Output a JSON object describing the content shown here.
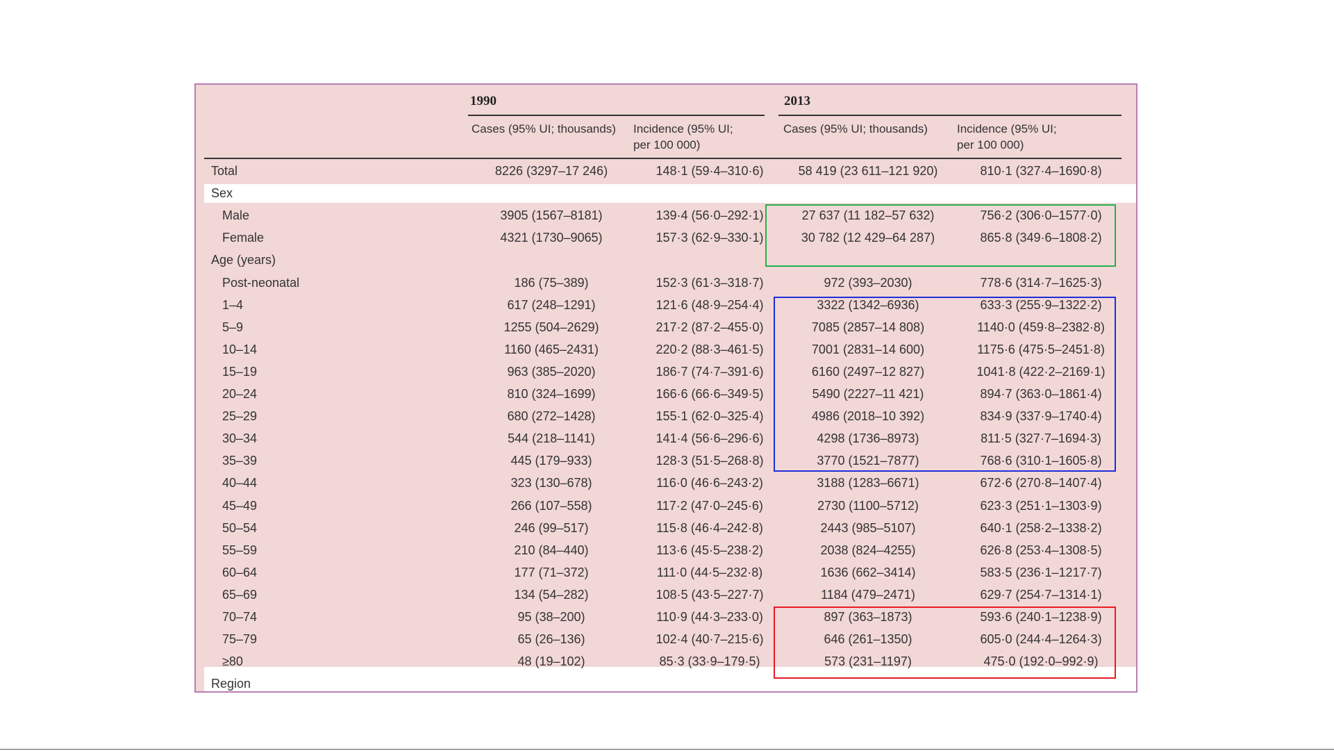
{
  "table": {
    "years": [
      "1990",
      "2013"
    ],
    "columns": [
      "Cases (95% UI; thousands)",
      "Incidence (95% UI;\nper 100 000)",
      "Cases (95% UI; thousands)",
      "Incidence (95% UI;\nper 100 000)"
    ],
    "rows": [
      {
        "label": "Total",
        "type": "data",
        "indent": false,
        "v": [
          "8226 (3297–17 246)",
          "148·1 (59·4–310·6)",
          "58 419 (23 611–121 920)",
          "810·1 (327·4–1690·8)"
        ]
      },
      {
        "label": "Sex",
        "type": "section",
        "indent": false,
        "v": [
          "",
          "",
          "",
          ""
        ]
      },
      {
        "label": "Male",
        "type": "data",
        "indent": true,
        "v": [
          "3905 (1567–8181)",
          "139·4 (56·0–292·1)",
          "27 637 (11 182–57 632)",
          "756·2 (306·0–1577·0)"
        ]
      },
      {
        "label": "Female",
        "type": "data",
        "indent": true,
        "v": [
          "4321 (1730–9065)",
          "157·3 (62·9–330·1)",
          "30 782 (12 429–64 287)",
          "865·8 (349·6–1808·2)"
        ]
      },
      {
        "label": "Age (years)",
        "type": "section",
        "indent": false,
        "v": [
          "",
          "",
          "",
          ""
        ]
      },
      {
        "label": "Post-neonatal",
        "type": "data",
        "indent": true,
        "v": [
          "186 (75–389)",
          "152·3 (61·3–318·7)",
          "972 (393–2030)",
          "778·6 (314·7–1625·3)"
        ]
      },
      {
        "label": "1–4",
        "type": "data",
        "indent": true,
        "v": [
          "617 (248–1291)",
          "121·6 (48·9–254·4)",
          "3322 (1342–6936)",
          "633·3 (255·9–1322·2)"
        ]
      },
      {
        "label": "5–9",
        "type": "data",
        "indent": true,
        "v": [
          "1255 (504–2629)",
          "217·2 (87·2–455·0)",
          "7085 (2857–14 808)",
          "1140·0 (459·8–2382·8)"
        ]
      },
      {
        "label": "10–14",
        "type": "data",
        "indent": true,
        "v": [
          "1160 (465–2431)",
          "220·2 (88·3–461·5)",
          "7001 (2831–14 600)",
          "1175·6 (475·5–2451·8)"
        ]
      },
      {
        "label": "15–19",
        "type": "data",
        "indent": true,
        "v": [
          "963 (385–2020)",
          "186·7 (74·7–391·6)",
          "6160 (2497–12 827)",
          "1041·8 (422·2–2169·1)"
        ]
      },
      {
        "label": "20–24",
        "type": "data",
        "indent": true,
        "v": [
          "810 (324–1699)",
          "166·6 (66·6–349·5)",
          "5490 (2227–11 421)",
          "894·7 (363·0–1861·4)"
        ]
      },
      {
        "label": "25–29",
        "type": "data",
        "indent": true,
        "v": [
          "680 (272–1428)",
          "155·1 (62·0–325·4)",
          "4986 (2018–10 392)",
          "834·9 (337·9–1740·4)"
        ]
      },
      {
        "label": "30–34",
        "type": "data",
        "indent": true,
        "v": [
          "544 (218–1141)",
          "141·4 (56·6–296·6)",
          "4298 (1736–8973)",
          "811·5 (327·7–1694·3)"
        ]
      },
      {
        "label": "35–39",
        "type": "data",
        "indent": true,
        "v": [
          "445 (179–933)",
          "128·3 (51·5–268·8)",
          "3770 (1521–7877)",
          "768·6 (310·1–1605·8)"
        ]
      },
      {
        "label": "40–44",
        "type": "data",
        "indent": true,
        "v": [
          "323 (130–678)",
          "116·0 (46·6–243·2)",
          "3188 (1283–6671)",
          "672·6 (270·8–1407·4)"
        ]
      },
      {
        "label": "45–49",
        "type": "data",
        "indent": true,
        "v": [
          "266 (107–558)",
          "117·2 (47·0–245·6)",
          "2730 (1100–5712)",
          "623·3 (251·1–1303·9)"
        ]
      },
      {
        "label": "50–54",
        "type": "data",
        "indent": true,
        "v": [
          "246 (99–517)",
          "115·8 (46·4–242·8)",
          "2443 (985–5107)",
          "640·1 (258·2–1338·2)"
        ]
      },
      {
        "label": "55–59",
        "type": "data",
        "indent": true,
        "v": [
          "210 (84–440)",
          "113·6 (45·5–238·2)",
          "2038 (824–4255)",
          "626·8 (253·4–1308·5)"
        ]
      },
      {
        "label": "60–64",
        "type": "data",
        "indent": true,
        "v": [
          "177 (71–372)",
          "111·0 (44·5–232·8)",
          "1636 (662–3414)",
          "583·5 (236·1–1217·7)"
        ]
      },
      {
        "label": "65–69",
        "type": "data",
        "indent": true,
        "v": [
          "134 (54–282)",
          "108·5 (43·5–227·7)",
          "1184 (479–2471)",
          "629·7 (254·7–1314·1)"
        ]
      },
      {
        "label": "70–74",
        "type": "data",
        "indent": true,
        "v": [
          "95 (38–200)",
          "110·9 (44·3–233·0)",
          "897 (363–1873)",
          "593·6 (240·1–1238·9)"
        ]
      },
      {
        "label": "75–79",
        "type": "data",
        "indent": true,
        "v": [
          "65 (26–136)",
          "102·4 (40·7–215·6)",
          "646 (261–1350)",
          "605·0 (244·4–1264·3)"
        ]
      },
      {
        "label": "≥80",
        "type": "data",
        "indent": true,
        "v": [
          "48 (19–102)",
          "85·3 (33·9–179·5)",
          "573 (231–1197)",
          "475·0 (192·0–992·9)"
        ]
      },
      {
        "label": "Region",
        "type": "section",
        "indent": false,
        "v": [
          "",
          "",
          "",
          ""
        ]
      }
    ]
  },
  "highlights": {
    "sex_box_color": "#22b14c",
    "middle_age_box_color": "#1f2fd6",
    "elderly_box_color": "#e81b23"
  },
  "colors": {
    "panel_bg": "#f2d7d7",
    "panel_border": "#b77fb0"
  }
}
